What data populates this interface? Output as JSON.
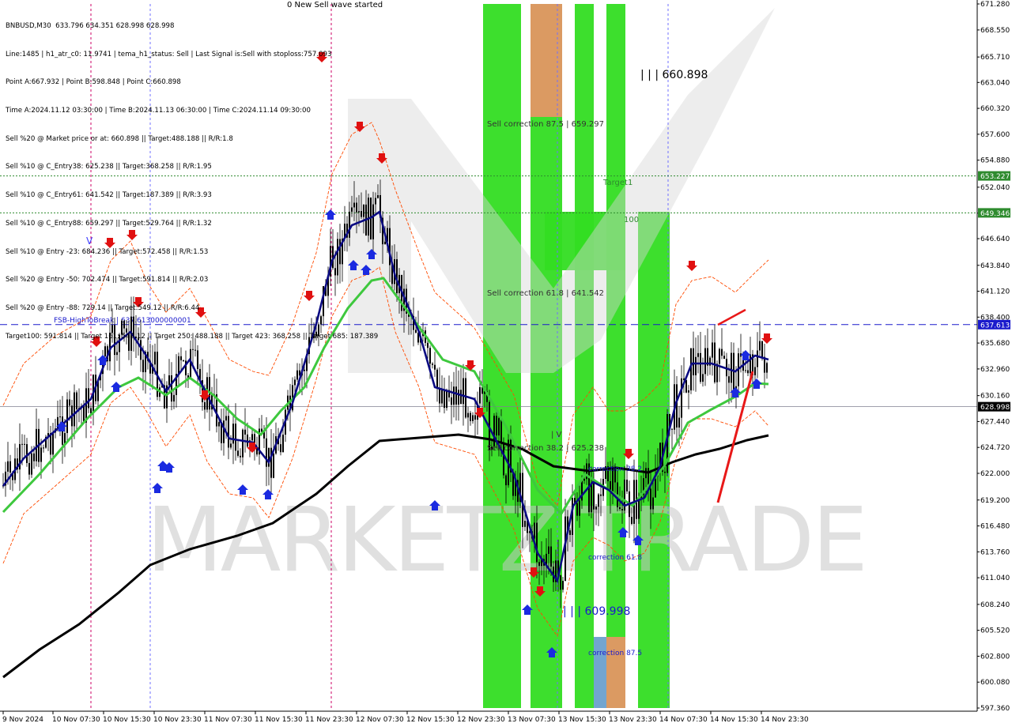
{
  "header": {
    "lines": [
      "BNBUSD,M30  633.796 634.351 628.998 628.998",
      "Line:1485 | h1_atr_c0: 11.9741 | tema_h1_status: Sell | Last Signal is:Sell with stoploss:757.093",
      "Point A:667.932 | Point B:598.848 | Point C:660.898",
      "Time A:2024.11.12 03:30:00 | Time B:2024.11.13 06:30:00 | Time C:2024.11.14 09:30:00",
      "Sell %20 @ Market price or at: 660.898 || Target:488.188 || R/R:1.8",
      "Sell %10 @ C_Entry38: 625.238 || Target:368.258 || R/R:1.95",
      "Sell %10 @ C_Entry61: 641.542 || Target:187.389 || R/R:3.93",
      "Sell %10 @ C_Entry88: 659.297 || Target:529.764 || R/R:1.32",
      "Sell %10 @ Entry -23: 684.236 || Target:572.458 || R/R:1.53",
      "Sell %20 @ Entry -50: 702.474 || Target:591.814 || R/R:2.03",
      "Sell %20 @ Entry -88: 729.14 || Target:549.12 || R/R:6.44",
      "Target100: 591.814 || Target 161: 549.12 || Target 250: 488.188 || Target 423: 368.258 || Target 685: 187.389"
    ],
    "top_notice": "0 New Sell wave started"
  },
  "chart_data": {
    "type": "candlestick",
    "symbol": "BNBUSD",
    "timeframe": "M30",
    "ylim": [
      597.36,
      671.28
    ],
    "y_ticks": [
      "671.280",
      "668.550",
      "665.710",
      "663.040",
      "660.320",
      "657.600",
      "654.880",
      "652.040",
      "649.320",
      "646.640",
      "643.840",
      "641.120",
      "638.400",
      "635.680",
      "632.960",
      "630.160",
      "627.440",
      "624.720",
      "622.000",
      "619.200",
      "616.480",
      "613.760",
      "611.040",
      "608.240",
      "605.520",
      "602.800",
      "600.080",
      "597.360"
    ],
    "x_ticks": [
      "9 Nov 2024",
      "10 Nov 07:30",
      "10 Nov 15:30",
      "10 Nov 23:30",
      "11 Nov 07:30",
      "11 Nov 15:30",
      "11 Nov 23:30",
      "12 Nov 07:30",
      "12 Nov 15:30",
      "12 Nov 23:30",
      "13 Nov 07:30",
      "13 Nov 15:30",
      "13 Nov 23:30",
      "14 Nov 07:30",
      "14 Nov 15:30",
      "14 Nov 23:30"
    ],
    "current_price": {
      "value": 628.998,
      "label": "628.998"
    },
    "horizontal_levels": [
      {
        "value": 653.227,
        "label": "653.227",
        "color": "#2e8b2e",
        "style": "dotted"
      },
      {
        "value": 649.346,
        "label": "649.346",
        "color": "#2e8b2e",
        "style": "dotted"
      },
      {
        "value": 637.613,
        "label": "637.613",
        "color": "#1a1acc",
        "style": "dashed",
        "text": "FSB-HighToBreak | 637.613000000001"
      }
    ],
    "annotations": [
      {
        "text": "| | | 660.898",
        "price": 660.898
      },
      {
        "text": "| | | 609.998",
        "price": 609.998
      },
      {
        "text": "Sell correction 87.5 | 659.297"
      },
      {
        "text": "Sell correction 61.8 | 641.542"
      },
      {
        "text": "Sell correction 38.2 | 625.238"
      },
      {
        "text": "correction 38.2"
      },
      {
        "text": "correction 61.8"
      },
      {
        "text": "correction 87.5"
      },
      {
        "text": "Target1"
      },
      {
        "text": "100"
      },
      {
        "text": "| V"
      },
      {
        "text": "V"
      }
    ],
    "watermark": "MARKETZITRADE",
    "colors": {
      "ma_fast": "#0a0a82",
      "ma_mid": "#3ec83e",
      "ma_slow": "#000000",
      "bands": "#ff4a00",
      "zone_green": "#33dd22",
      "zone_orange": "#d9955a",
      "zone_blue": "#6aa0cc",
      "buy_arrow": "#1a2ae0",
      "sell_arrow": "#e01010",
      "trendline": "#e81818"
    }
  }
}
